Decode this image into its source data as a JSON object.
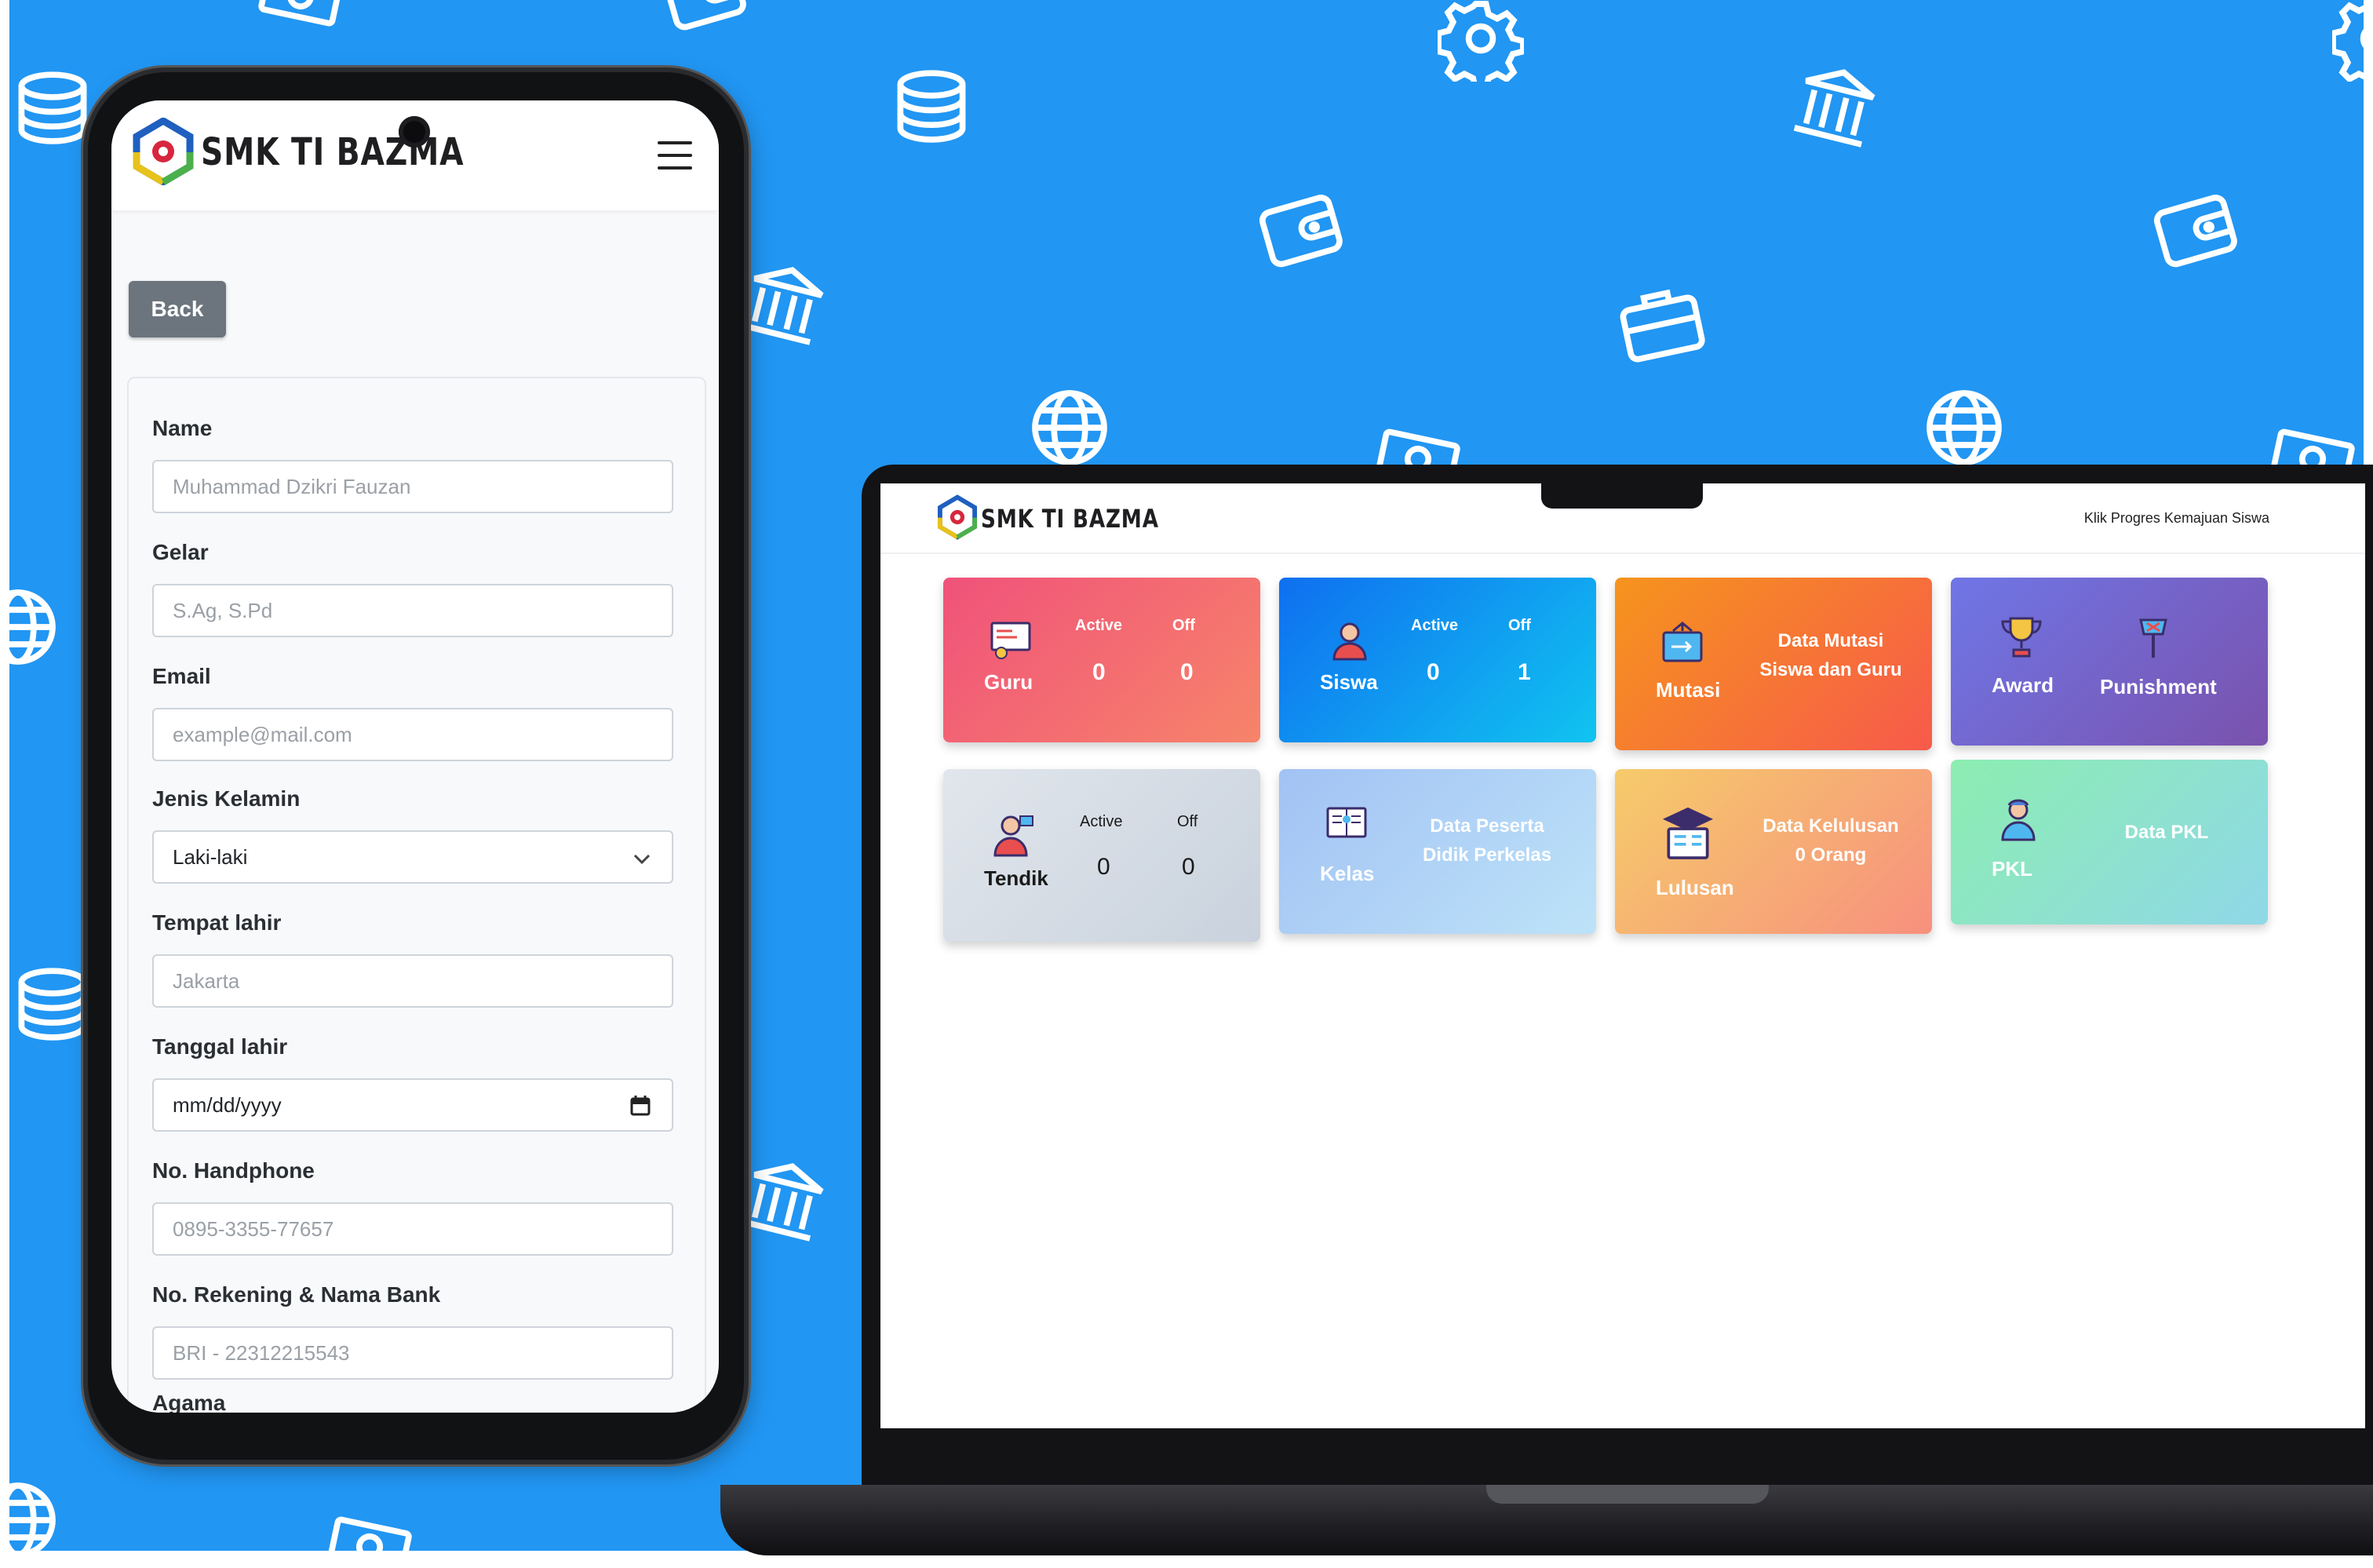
{
  "brand": {
    "name": "SMK TI BAZMA"
  },
  "colors": {
    "background": "#2196f3",
    "back_button": "#6c757d",
    "guru_tile": [
      "#f0527a",
      "#f7846a"
    ],
    "siswa_tile": [
      "#0f6ff0",
      "#10c4f0"
    ],
    "mutasi_tile": [
      "#f6941d",
      "#f75a4b"
    ],
    "award_tile": [
      "#6f76e6",
      "#7a52ad"
    ],
    "tendik_tile": [
      "#e1e6ec",
      "#c9d2dd"
    ],
    "kelas_tile": [
      "#a2c2f4",
      "#bde3f8"
    ],
    "lulusan_tile": [
      "#f6cb6a",
      "#f7907e"
    ],
    "pkl_tile": [
      "#8cedb0",
      "#8fd8e8"
    ]
  },
  "phone": {
    "header": {
      "menu_icon": "hamburger-menu-icon"
    },
    "back_label": "Back",
    "form": {
      "name_label": "Name",
      "name_placeholder": "Muhammad Dzikri Fauzan",
      "gelar_label": "Gelar",
      "gelar_placeholder": "S.Ag, S.Pd",
      "email_label": "Email",
      "email_placeholder": "example@mail.com",
      "gender_label": "Jenis Kelamin",
      "gender_value": "Laki-laki",
      "birthplace_label": "Tempat lahir",
      "birthplace_placeholder": "Jakarta",
      "birthdate_label": "Tanggal lahir",
      "birthdate_value": "mm/dd/yyyy",
      "phone_label": "No. Handphone",
      "phone_placeholder": "0895-3355-77657",
      "bank_label": "No. Rekening & Nama Bank",
      "bank_placeholder": "BRI - 22312215543",
      "religion_label": "Agama"
    }
  },
  "laptop": {
    "header_link": "Klik Progres Kemajuan Siswa",
    "tiles": {
      "guru": {
        "label": "Guru",
        "active_label": "Active",
        "off_label": "Off",
        "active": "0",
        "off": "0"
      },
      "siswa": {
        "label": "Siswa",
        "active_label": "Active",
        "off_label": "Off",
        "active": "0",
        "off": "1"
      },
      "mutasi": {
        "label": "Mutasi",
        "text_line1": "Data Mutasi",
        "text_line2": "Siswa dan Guru"
      },
      "award": {
        "label": "Award",
        "punishment_label": "Punishment"
      },
      "tendik": {
        "label": "Tendik",
        "active_label": "Active",
        "off_label": "Off",
        "active": "0",
        "off": "0"
      },
      "kelas": {
        "label": "Kelas",
        "text_line1": "Data Peserta",
        "text_line2": "Didik Perkelas"
      },
      "lulusan": {
        "label": "Lulusan",
        "text_line1": "Data Kelulusan",
        "text_line2": "0 Orang"
      },
      "pkl": {
        "label": "PKL",
        "text": "Data PKL"
      }
    }
  }
}
